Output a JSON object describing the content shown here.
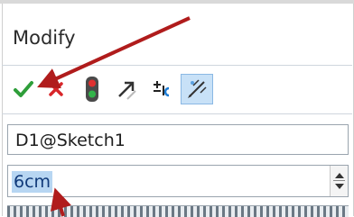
{
  "dialog": {
    "title": "Modify"
  },
  "toolbar": {
    "buttons": [
      {
        "name": "ok-button",
        "icon": "checkmark-icon"
      },
      {
        "name": "cancel-button",
        "icon": "x-icon"
      },
      {
        "name": "rebuild-button",
        "icon": "traffic-light-icon"
      },
      {
        "name": "reverse-sense-button",
        "icon": "diagonal-arrow-icon"
      },
      {
        "name": "increment-button",
        "icon": "plus-minus-icon"
      },
      {
        "name": "mark-for-drawing-button",
        "icon": "dimension-marker-icon",
        "active": true
      }
    ]
  },
  "fields": {
    "dimension_name": "D1@Sketch1",
    "value": "6cm"
  },
  "colors": {
    "check_green": "#2e9e3a",
    "cancel_red": "#d8262a",
    "annotation_arrow": "#b01c1c",
    "selection_highlight": "#b7d6f2"
  }
}
